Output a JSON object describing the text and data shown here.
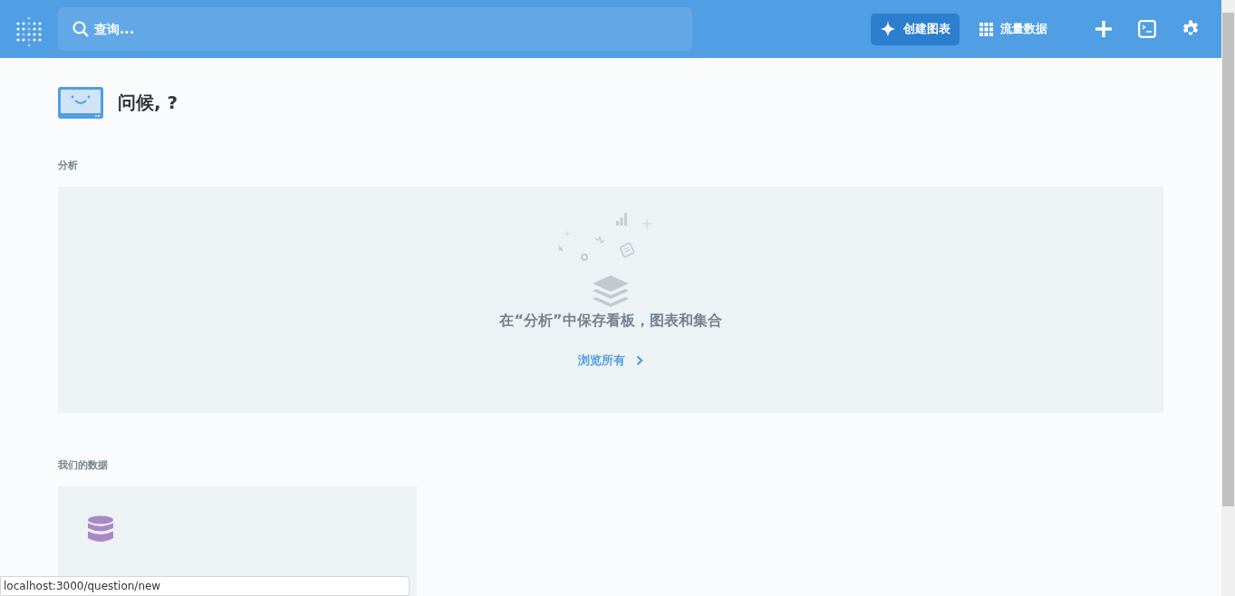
{
  "navbar": {
    "search": {
      "placeholder": "查询..."
    },
    "create_button": "创建图表",
    "browse_link": "流量数据"
  },
  "greeting": "问候, ?",
  "collections_section": {
    "heading": "分析",
    "empty_message": "在“分析”中保存看板，图表和集合",
    "browse_all_link": "浏览所有"
  },
  "data_section": {
    "heading": "我们的数据",
    "databases": [
      {
        "kind": "database"
      }
    ]
  },
  "status_bar": {
    "url": "localhost:3000/question/new"
  }
}
